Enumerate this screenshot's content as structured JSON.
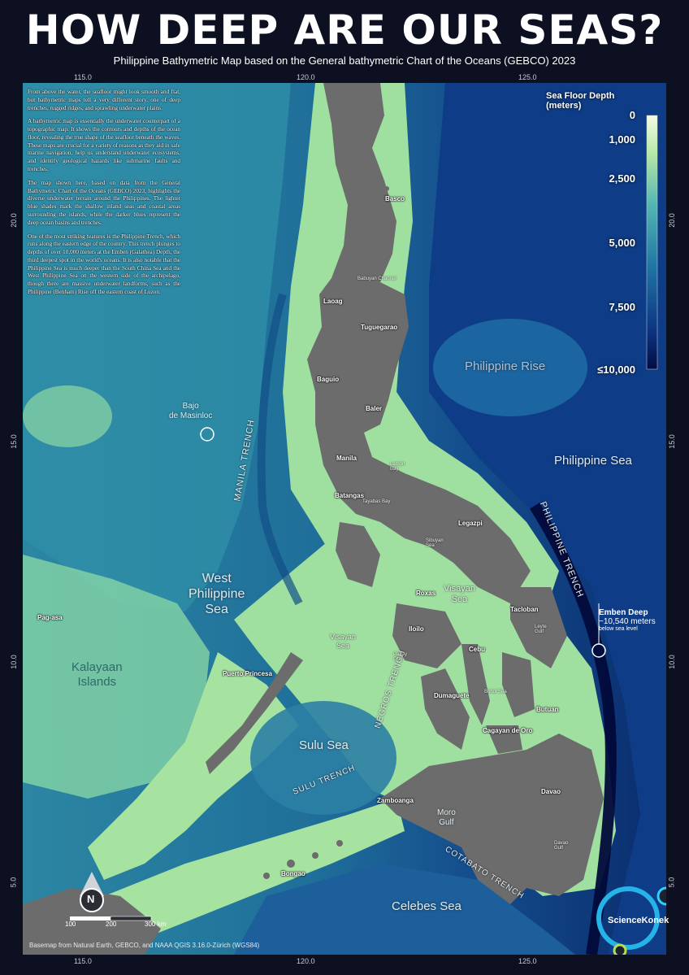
{
  "header": {
    "title": "HOW DEEP ARE OUR SEAS?",
    "subtitle": "Philippine Bathymetric Map based on the General bathymetric Chart of the Oceans (GEBCO) 2023"
  },
  "axes": {
    "lon_top": [
      "115.0",
      "120.0",
      "125.0"
    ],
    "lon_bottom": [
      "115.0",
      "120.0",
      "125.0"
    ],
    "lat_left": [
      "20.0",
      "15.0",
      "10.0",
      "5.0"
    ],
    "lat_right": [
      "20.0",
      "15.0",
      "10.0",
      "5.0"
    ]
  },
  "intro": {
    "p1": "From above the water, the seafloor might look smooth and flat, but bathymetric maps tell a very different story, one of deep trenches, rugged ridges, and sprawling underwater plains.",
    "p2": "A bathymetric map is essentially the underwater counterpart of a topographic map. It shows the contours and depths of the ocean floor, revealing the true shape of the seafloor beneath the waves. These maps are crucial for a variety of reasons as they aid in safe marine navigation, help us understand underwater ecosystems, and identify geological hazards like submarine faults and trenches.",
    "p3": "The map shown here, based on data from the General Bathymetric Chart of the Oceans (GEBCO) 2023, highlights the diverse underwater terrain around the Philippines. The lighter blue shades mark the shallow inland seas and coastal areas surrounding the islands, while the darker blues represent the deep ocean basins and trenches.",
    "p4": "One of the most striking features is the Philippine Trench, which runs along the eastern edge of the country. This trench plunges to depths of over 10,000 meters at the Emben (Galathea) Depth, the third deepest spot in the world's oceans. It is also notable that the Philippine Sea is much deeper than the South China Sea and the West Philippine Sea on the western side of the archipelago, though there are massive underwater landforms, such as the Philippine (Benham) Rise off the eastern coast of Luzon."
  },
  "legend": {
    "title": "Sea Floor Depth (meters)",
    "ticks": [
      "0",
      "1,000",
      "2,500",
      "5,000",
      "7,500",
      "≤10,000"
    ],
    "colors": [
      "#f2fbe2",
      "#a9e4a0",
      "#3fa8b8",
      "#1b6b9e",
      "#0b2f7a",
      "#020a3a"
    ]
  },
  "seas": {
    "west_philippine": "West\nPhilippine\nSea",
    "philippine_sea": "Philippine Sea",
    "philippine_rise": "Philippine Rise",
    "sulu_sea": "Sulu Sea",
    "celebes_sea": "Celebes Sea",
    "visayan_sea_c": "Visayan\nSea",
    "visayan_sea_w": "Visayan\nSea",
    "kalayaan": "Kalayaan\nIslands",
    "bajo": "Bajo\nde Masinloc",
    "moro_gulf": "Moro\nGulf"
  },
  "trenches": {
    "manila": "MANILA TRENCH",
    "philippine": "PHILIPPINE TRENCH",
    "negros": "NEGROS TRENCH",
    "sulu": "SULU TRENCH",
    "cotabato": "COTABATO TRENCH"
  },
  "cities": {
    "basco": "Basco",
    "laoag": "Laoag",
    "tuguegarao": "Tuguegarao",
    "baguio": "Baguio",
    "baler": "Baler",
    "manila": "Manila",
    "batangas": "Batangas",
    "legazpi": "Legazpi",
    "roxas": "Roxas",
    "iloilo": "Iloilo",
    "tacloban": "Tacloban",
    "cebu": "Cebu",
    "puerto_princesa": "Puerto Princesa",
    "dumaguete": "Dumaguete",
    "butuan": "Butuan",
    "cagayan": "Cagayan de Oro",
    "zamboanga": "Zamboanga",
    "davao": "Davao",
    "bongao": "Bongao",
    "pagasa": "Pag-asa"
  },
  "minor_labels": {
    "babuyan": "Babuyan Channel",
    "lamon": "Lamon\nBay",
    "sibuyan": "Sibuyan\nSea",
    "leyte": "Leyte\nGulf",
    "panay": "Panay\nGulf",
    "bohol": "Bohol Sea",
    "davao_gulf": "Davao\nGulf",
    "tayabas": "Tayabas Bay"
  },
  "emben": {
    "name": "Emben Deep",
    "depth": "~10,540 meters",
    "note": "below sea level"
  },
  "scale": {
    "labels": [
      "100",
      "200",
      "300 km"
    ]
  },
  "north": "N",
  "footer": "Basemap from Natural Earth, GEBCO, and NAAA QGIS 3.16.0-Zürich (WGS84)",
  "brand": "ScienceKonek"
}
